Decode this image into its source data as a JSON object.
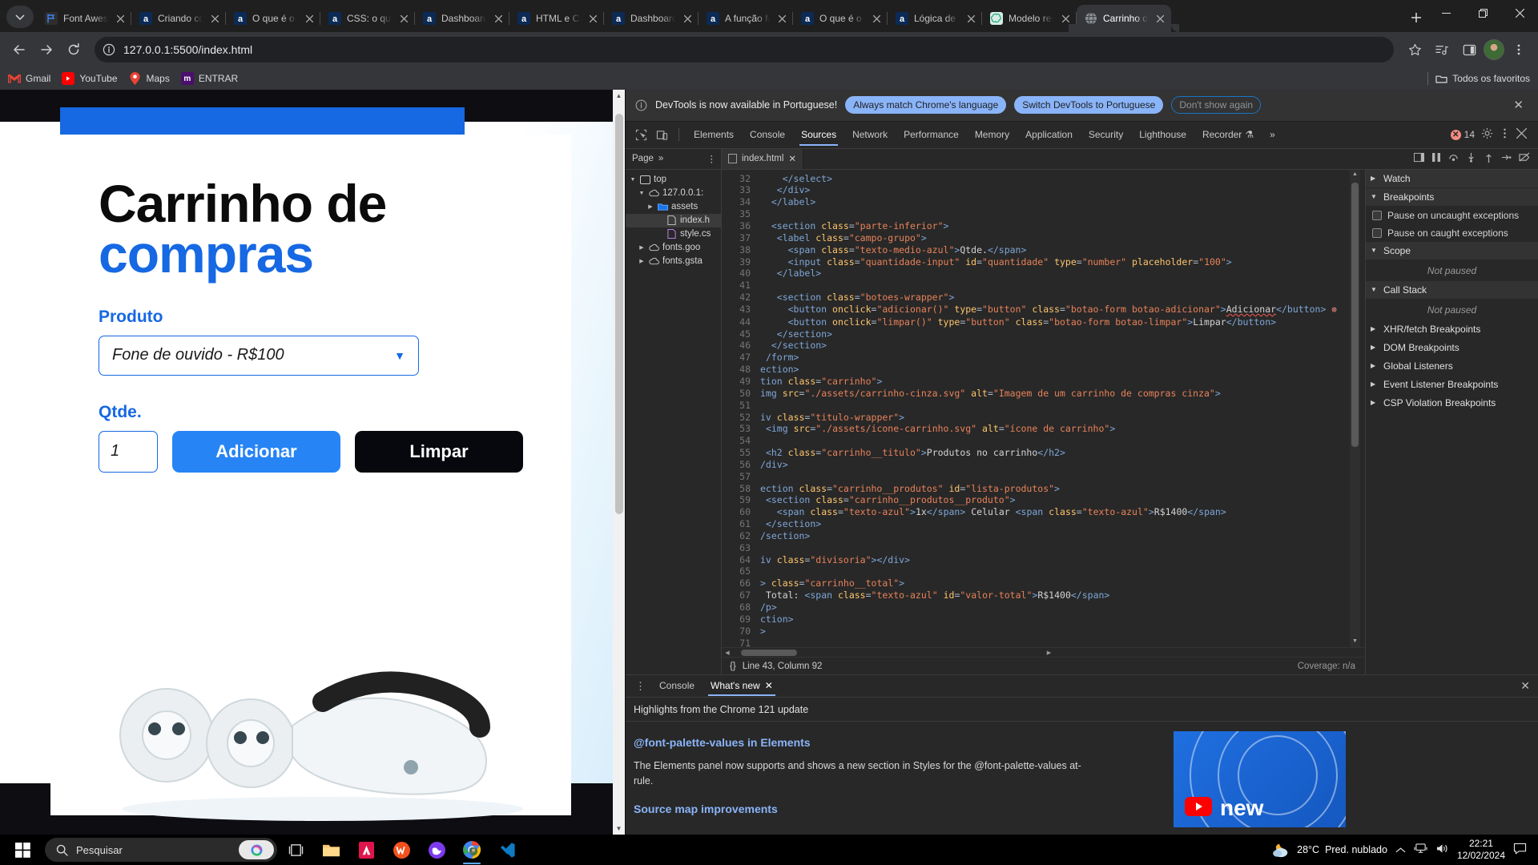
{
  "browser": {
    "tabs": [
      {
        "title": "Font Awesome",
        "favicon": "fontawesome-icon"
      },
      {
        "title": "Criando com",
        "favicon": "alura-icon"
      },
      {
        "title": "O que é o HT",
        "favicon": "alura-icon"
      },
      {
        "title": "CSS: o que é",
        "favicon": "alura-icon"
      },
      {
        "title": "Dashboard |",
        "favicon": "alura-icon"
      },
      {
        "title": "HTML e CSS",
        "favicon": "alura-icon"
      },
      {
        "title": "Dashboard |",
        "favicon": "alura-icon"
      },
      {
        "title": "A função Ma",
        "favicon": "alura-icon"
      },
      {
        "title": "O que é o D",
        "favicon": "alura-icon"
      },
      {
        "title": "Lógica de pr",
        "favicon": "alura-icon"
      },
      {
        "title": "Modelo resu",
        "favicon": "chatgpt-icon"
      },
      {
        "title": "Carrinho de c",
        "favicon": "globe-icon",
        "active": true
      }
    ],
    "window_controls": {
      "minimize": "—",
      "maximize": "❐",
      "close": "✕"
    },
    "new_tab_label": "+",
    "toolbar": {
      "back": "back-arrow",
      "forward": "forward-arrow",
      "reload": "reload-icon",
      "url": "127.0.0.1:5500/index.html",
      "bookmark_star": "star-icon",
      "media": "media-icon",
      "sidepanel": "side-panel-icon",
      "menu": "three-dots-icon"
    },
    "bookmarks": [
      {
        "label": "Gmail",
        "icon": "gmail-icon"
      },
      {
        "label": "YouTube",
        "icon": "youtube-icon"
      },
      {
        "label": "Maps",
        "icon": "maps-icon"
      },
      {
        "label": "ENTRAR",
        "icon": "moodle-icon"
      }
    ],
    "bookmarks_right": {
      "label": "Todos os favoritos",
      "icon": "folder-icon"
    }
  },
  "page": {
    "title_line1": "Carrinho de",
    "title_line2": "compras",
    "produto_label": "Produto",
    "produto_value": "Fone de ouvido - R$100",
    "qtde_label": "Qtde.",
    "qtde_value": "1",
    "btn_adicionar": "Adicionar",
    "btn_limpar": "Limpar",
    "accent_color": "#1668e3",
    "button_blue": "#2684f5",
    "button_dark": "#06080d"
  },
  "devtools": {
    "notice": {
      "text": "DevTools is now available in Portuguese!",
      "btn_always": "Always match Chrome's language",
      "btn_switch": "Switch DevTools to Portuguese",
      "btn_dismiss": "Don't show again",
      "close": "✕"
    },
    "panels": [
      "Elements",
      "Console",
      "Sources",
      "Network",
      "Performance",
      "Memory",
      "Application",
      "Security",
      "Lighthouse",
      "Recorder"
    ],
    "selected_panel": "Sources",
    "more_panels": "»",
    "error_count": "14",
    "subbar": {
      "nav_label": "Page",
      "more": "»",
      "file_tab": "index.html",
      "file_tab_close": "✕"
    },
    "filetree": [
      {
        "label": "top",
        "depth": 0,
        "arrow": "▼",
        "icon": "frame-icon"
      },
      {
        "label": "127.0.0.1:",
        "depth": 1,
        "arrow": "▼",
        "icon": "cloud-icon"
      },
      {
        "label": "assets",
        "depth": 2,
        "arrow": "▶",
        "icon": "folder-blue-icon"
      },
      {
        "label": "index.h",
        "depth": 3,
        "arrow": "",
        "icon": "file-icon",
        "selected": true
      },
      {
        "label": "style.cs",
        "depth": 3,
        "arrow": "",
        "icon": "file-css-icon"
      },
      {
        "label": "fonts.goo",
        "depth": 1,
        "arrow": "▶",
        "icon": "cloud-icon"
      },
      {
        "label": "fonts.gsta",
        "depth": 1,
        "arrow": "▶",
        "icon": "cloud-icon"
      }
    ],
    "code_lines": [
      {
        "n": 32,
        "html": "    <span class='tg'>&lt;/select&gt;</span>"
      },
      {
        "n": 33,
        "html": "   <span class='tg'>&lt;/div&gt;</span>"
      },
      {
        "n": 34,
        "html": "  <span class='tg'>&lt;/label&gt;</span>"
      },
      {
        "n": 35,
        "html": ""
      },
      {
        "n": 36,
        "html": "  <span class='tg'>&lt;section</span> <span class='at'>class</span>=<span class='st'>\"parte-inferior\"</span><span class='tg'>&gt;</span>"
      },
      {
        "n": 37,
        "html": "   <span class='tg'>&lt;label</span> <span class='at'>class</span>=<span class='st'>\"campo-grupo\"</span><span class='tg'>&gt;</span>"
      },
      {
        "n": 38,
        "html": "     <span class='tg'>&lt;span</span> <span class='at'>class</span>=<span class='st'>\"texto-medio-azul\"</span><span class='tg'>&gt;</span><span class='tx'>Qtde.</span><span class='tg'>&lt;/span&gt;</span>"
      },
      {
        "n": 39,
        "html": "     <span class='tg'>&lt;input</span> <span class='at'>class</span>=<span class='st'>\"quantidade-input\"</span> <span class='at'>id</span>=<span class='st'>\"quantidade\"</span> <span class='at'>type</span>=<span class='st'>\"number\"</span> <span class='at'>placeholder</span>=<span class='st'>\"100\"</span><span class='tg'>&gt;</span>"
      },
      {
        "n": 40,
        "html": "   <span class='tg'>&lt;/label&gt;</span>"
      },
      {
        "n": 41,
        "html": ""
      },
      {
        "n": 42,
        "html": "   <span class='tg'>&lt;section</span> <span class='at'>class</span>=<span class='st'>\"botoes-wrapper\"</span><span class='tg'>&gt;</span>"
      },
      {
        "n": 43,
        "html": "     <span class='tg'>&lt;button</span> <span class='at'>onclick</span>=<span class='st'>\"adicionar()\"</span> <span class='at'>type</span>=<span class='st'>\"button\"</span> <span class='at'>class</span>=<span class='st'>\"botao-form botao-adicionar\"</span><span class='tg'>&gt;</span><span class='tx squiggle'>Adicionar</span><span class='tg'>&lt;/button&gt;</span>",
        "error": true
      },
      {
        "n": 44,
        "html": "     <span class='tg'>&lt;button</span> <span class='at'>onclick</span>=<span class='st'>\"limpar()\"</span> <span class='at'>type</span>=<span class='st'>\"button\"</span> <span class='at'>class</span>=<span class='st'>\"botao-form botao-limpar\"</span><span class='tg'>&gt;</span><span class='tx'>Limpar</span><span class='tg'>&lt;/button&gt;</span>"
      },
      {
        "n": 45,
        "html": "   <span class='tg'>&lt;/section&gt;</span>"
      },
      {
        "n": 46,
        "html": "  <span class='tg'>&lt;/section&gt;</span>"
      },
      {
        "n": 47,
        "html": " <span class='tg'>/form&gt;</span>"
      },
      {
        "n": 48,
        "html": "<span class='tg'>ection&gt;</span>"
      },
      {
        "n": 49,
        "html": "<span class='tg'>tion</span> <span class='at'>class</span>=<span class='st'>\"carrinho\"</span><span class='tg'>&gt;</span>"
      },
      {
        "n": 50,
        "html": "<span class='tg'>img</span> <span class='at'>src</span>=<span class='st'>\"./assets/carrinho-cinza.svg\"</span> <span class='at'>alt</span>=<span class='st'>\"Imagem de um carrinho de compras cinza\"</span><span class='tg'>&gt;</span>"
      },
      {
        "n": 51,
        "html": ""
      },
      {
        "n": 52,
        "html": "<span class='tg'>iv</span> <span class='at'>class</span>=<span class='st'>\"titulo-wrapper\"</span><span class='tg'>&gt;</span>"
      },
      {
        "n": 53,
        "html": " <span class='tg'>&lt;img</span> <span class='at'>src</span>=<span class='st'>\"./assets/icone-carrinho.svg\"</span> <span class='at'>alt</span>=<span class='st'>\"ícone de carrinho\"</span><span class='tg'>&gt;</span>"
      },
      {
        "n": 54,
        "html": ""
      },
      {
        "n": 55,
        "html": " <span class='tg'>&lt;h2</span> <span class='at'>class</span>=<span class='st'>\"carrinho__titulo\"</span><span class='tg'>&gt;</span><span class='tx'>Produtos no carrinho</span><span class='tg'>&lt;/h2&gt;</span>"
      },
      {
        "n": 56,
        "html": "<span class='tg'>/div&gt;</span>"
      },
      {
        "n": 57,
        "html": ""
      },
      {
        "n": 58,
        "html": "<span class='tg'>ection</span> <span class='at'>class</span>=<span class='st'>\"carrinho__produtos\"</span> <span class='at'>id</span>=<span class='st'>\"lista-produtos\"</span><span class='tg'>&gt;</span>"
      },
      {
        "n": 59,
        "html": " <span class='tg'>&lt;section</span> <span class='at'>class</span>=<span class='st'>\"carrinho__produtos__produto\"</span><span class='tg'>&gt;</span>"
      },
      {
        "n": 60,
        "html": "   <span class='tg'>&lt;span</span> <span class='at'>class</span>=<span class='st'>\"texto-azul\"</span><span class='tg'>&gt;</span><span class='tx'>1x</span><span class='tg'>&lt;/span&gt;</span> <span class='tx'>Celular</span> <span class='tg'>&lt;span</span> <span class='at'>class</span>=<span class='st'>\"texto-azul\"</span><span class='tg'>&gt;</span><span class='tx'>R$1400</span><span class='tg'>&lt;/span&gt;</span>"
      },
      {
        "n": 61,
        "html": " <span class='tg'>&lt;/section&gt;</span>"
      },
      {
        "n": 62,
        "html": "<span class='tg'>/section&gt;</span>"
      },
      {
        "n": 63,
        "html": ""
      },
      {
        "n": 64,
        "html": "<span class='tg'>iv</span> <span class='at'>class</span>=<span class='st'>\"divisoria\"</span><span class='tg'>&gt;&lt;/div&gt;</span>"
      },
      {
        "n": 65,
        "html": ""
      },
      {
        "n": 66,
        "html": "<span class='tg'>&gt;</span> <span class='at'>class</span>=<span class='st'>\"carrinho__total\"</span><span class='tg'>&gt;</span>"
      },
      {
        "n": 67,
        "html": " <span class='tx'>Total:</span> <span class='tg'>&lt;span</span> <span class='at'>class</span>=<span class='st'>\"texto-azul\"</span> <span class='at'>id</span>=<span class='st'>\"valor-total\"</span><span class='tg'>&gt;</span><span class='tx'>R$1400</span><span class='tg'>&lt;/span&gt;</span>"
      },
      {
        "n": 68,
        "html": "<span class='tg'>/p&gt;</span>"
      },
      {
        "n": 69,
        "html": "<span class='tg'>ction&gt;</span>"
      },
      {
        "n": 70,
        "html": "<span class='tg'>&gt;</span>"
      },
      {
        "n": 71,
        "html": ""
      }
    ],
    "status": {
      "format_icon": "{}",
      "position": "Line 43, Column 92",
      "coverage": "Coverage: n/a"
    },
    "debugger_panel": {
      "watch": "Watch",
      "breakpoints": "Breakpoints",
      "pause_uncaught": "Pause on uncaught exceptions",
      "pause_caught": "Pause on caught exceptions",
      "scope": "Scope",
      "scope_state": "Not paused",
      "call_stack": "Call Stack",
      "call_stack_state": "Not paused",
      "xhr": "XHR/fetch Breakpoints",
      "dom": "DOM Breakpoints",
      "global": "Global Listeners",
      "event_listener": "Event Listener Breakpoints",
      "csp": "CSP Violation Breakpoints"
    },
    "drawer": {
      "tab_console": "Console",
      "tab_whatsnew": "What's new",
      "tab_close": "✕",
      "drawer_close": "✕",
      "headline": "Highlights from the Chrome 121 update",
      "section1_title": "@font-palette-values in Elements",
      "section1_body": "The Elements panel now supports and shows a new section in Styles for the @font-palette-values at-rule.",
      "section2_title": "Source map improvements",
      "thumb_label": "new"
    }
  },
  "taskbar": {
    "start": "windows-start-icon",
    "search_placeholder": "Pesquisar",
    "icons": [
      "task-view-icon",
      "file-explorer-icon",
      "adobe-icon",
      "wps-writer-icon",
      "dove-icon",
      "chrome-icon",
      "vscode-icon"
    ],
    "weather_temp": "28°C",
    "weather_desc": "Pred. nublado",
    "time": "22:21",
    "date": "12/02/2024",
    "tray": [
      "chevron-up-icon",
      "network-icon",
      "volume-icon",
      "notification-icon"
    ]
  }
}
